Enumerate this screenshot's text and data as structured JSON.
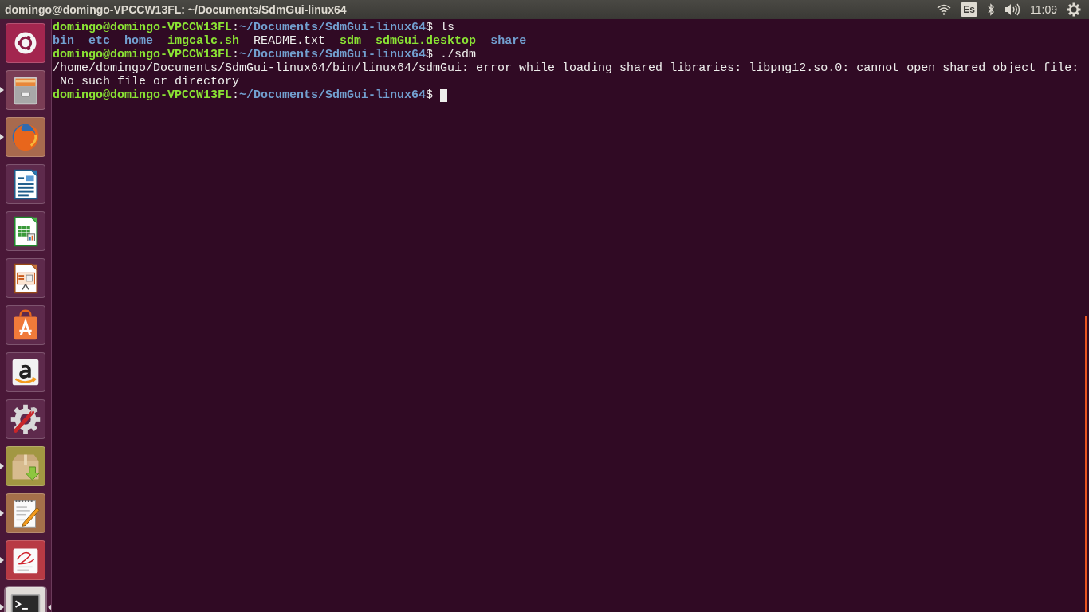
{
  "top_bar": {
    "title": "domingo@domingo-VPCCW13FL: ~/Documents/SdmGui-linux64",
    "keyboard_layout": "Es",
    "clock": "11:09"
  },
  "launcher": {
    "items": [
      {
        "kind": "dash",
        "running": false,
        "focused": false
      },
      {
        "kind": "files",
        "running": true,
        "focused": false
      },
      {
        "kind": "browser",
        "running": true,
        "focused": false
      },
      {
        "kind": "writer",
        "running": false,
        "focused": false
      },
      {
        "kind": "calc",
        "running": false,
        "focused": false
      },
      {
        "kind": "impress",
        "running": false,
        "focused": false
      },
      {
        "kind": "software",
        "running": false,
        "focused": false
      },
      {
        "kind": "shop",
        "running": false,
        "focused": false
      },
      {
        "kind": "settings",
        "running": false,
        "focused": false
      },
      {
        "kind": "archive",
        "running": true,
        "focused": false
      },
      {
        "kind": "editor",
        "running": true,
        "focused": false
      },
      {
        "kind": "viewer",
        "running": true,
        "focused": false
      },
      {
        "kind": "terminal",
        "running": true,
        "focused": true
      }
    ]
  },
  "terminal": {
    "lines": [
      {
        "kind": "prompt",
        "user_host": "domingo@domingo-VPCCW13FL",
        "separator": ":",
        "path": "~/Documents/SdmGui-linux64",
        "command": "$ ls"
      },
      {
        "kind": "listing",
        "entries": [
          {
            "name": "bin",
            "color": "#729fcf",
            "bold": true
          },
          {
            "name": "etc",
            "color": "#729fcf",
            "bold": true
          },
          {
            "name": "home",
            "color": "#729fcf",
            "bold": true
          },
          {
            "name": "imgcalc.sh",
            "color": "#8ae234",
            "bold": true
          },
          {
            "name": "README.txt",
            "color": "#eeeeec",
            "bold": false
          },
          {
            "name": "sdm",
            "color": "#8ae234",
            "bold": true
          },
          {
            "name": "sdmGui.desktop",
            "color": "#8ae234",
            "bold": true
          },
          {
            "name": "share",
            "color": "#729fcf",
            "bold": true
          }
        ]
      },
      {
        "kind": "prompt",
        "user_host": "domingo@domingo-VPCCW13FL",
        "separator": ":",
        "path": "~/Documents/SdmGui-linux64",
        "command": "$ ./sdm"
      },
      {
        "kind": "output",
        "text": "/home/domingo/Documents/SdmGui-linux64/bin/linux64/sdmGui: error while loading shared libraries: libpng12.so.0: cannot open shared object file:"
      },
      {
        "kind": "output",
        "text": " No such file or directory"
      },
      {
        "kind": "prompt",
        "user_host": "domingo@domingo-VPCCW13FL",
        "separator": ":",
        "path": "~/Documents/SdmGui-linux64",
        "command": "$ ",
        "cursor": true
      }
    ]
  }
}
